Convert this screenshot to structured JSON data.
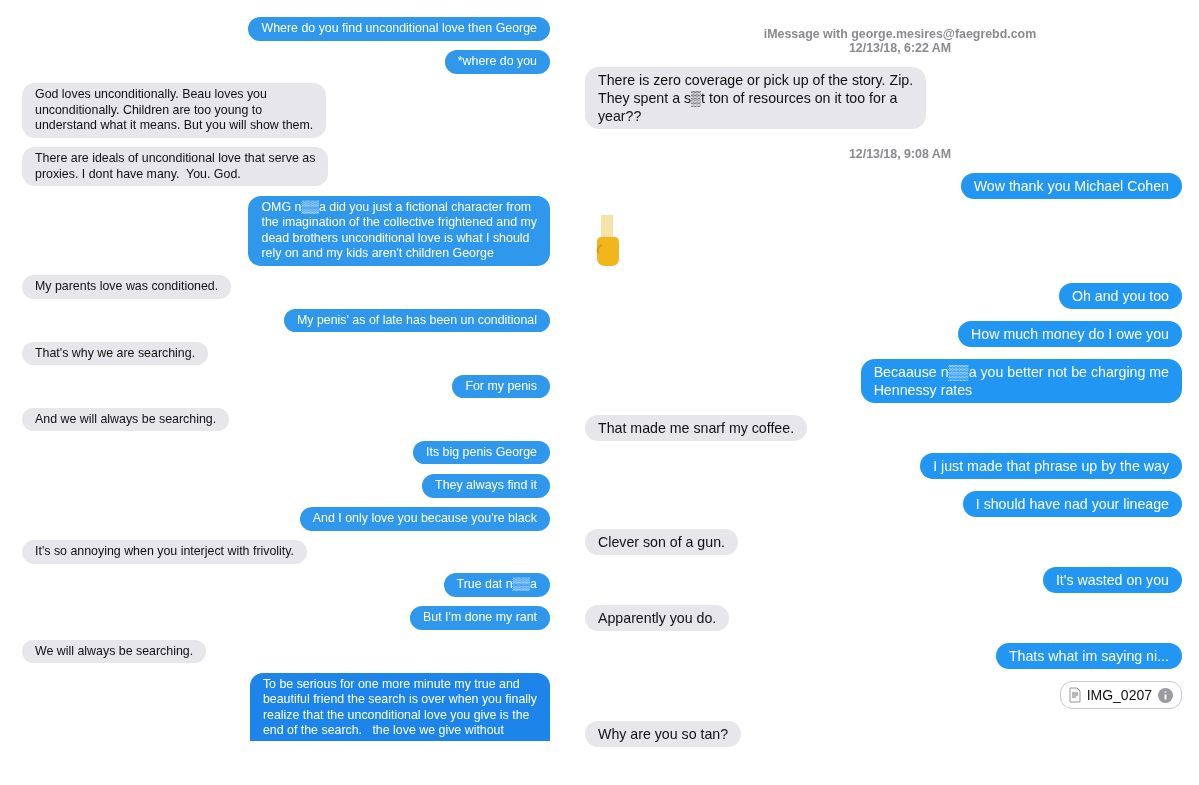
{
  "left_thread": {
    "messages": [
      {
        "kind": "outgoing",
        "text": "Where do you find unconditional love then George"
      },
      {
        "kind": "outgoing",
        "text": "*where do you"
      },
      {
        "kind": "incoming",
        "text": "God loves unconditionally. Beau loves you\nunconditionally. Children are too young to\nunderstand what it means. But you will show them."
      },
      {
        "kind": "incoming",
        "text": "There are ideals of unconditional love that serve as\nproxies. I dont have many.  You. God."
      },
      {
        "kind": "outgoing",
        "text": "OMG n▒▒a did you just a fictional character from\nthe imagination of the collective frightened and my\ndead brothers unconditional love is what I should\nrely on and my kids aren't children George"
      },
      {
        "kind": "incoming",
        "text": "My parents love was conditioned."
      },
      {
        "kind": "outgoing",
        "text": "My penis' as of late has been un conditional"
      },
      {
        "kind": "incoming",
        "text": "That's why we are searching."
      },
      {
        "kind": "outgoing",
        "text": "For my penis"
      },
      {
        "kind": "incoming",
        "text": "And we will always be searching."
      },
      {
        "kind": "outgoing",
        "text": "Its big penis George"
      },
      {
        "kind": "outgoing",
        "text": "They always find it"
      },
      {
        "kind": "outgoing",
        "text": "And I only love you because you're black"
      },
      {
        "kind": "incoming",
        "text": "It's so annoying when you interject with frivolity."
      },
      {
        "kind": "outgoing",
        "text": "True dat n▒▒a"
      },
      {
        "kind": "outgoing",
        "text": "But I'm done my rant"
      },
      {
        "kind": "incoming",
        "text": "We will always be searching."
      },
      {
        "kind": "outgoing",
        "text": "To be serious for one more minute my true and\nbeautiful friend the search is over when you finally\nrealize that the unconditional love you give is the\nend of the search.   the love we give without"
      }
    ]
  },
  "right_thread": {
    "header": "iMessage with george.mesires@faegrebd.com",
    "items": [
      {
        "kind": "timestamp",
        "text": "12/13/18, 6:22 AM"
      },
      {
        "kind": "incoming",
        "text": "There is zero coverage or pick up of the story. Zip.\nThey spent a s▒t ton of resources on it too for a\nyear??"
      },
      {
        "kind": "timestamp",
        "text": "12/13/18, 9:08 AM"
      },
      {
        "kind": "outgoing",
        "text": "Wow thank you Michael Cohen"
      },
      {
        "kind": "emoji"
      },
      {
        "kind": "outgoing",
        "text": "Oh and you too"
      },
      {
        "kind": "outgoing",
        "text": "How much money do I owe you"
      },
      {
        "kind": "outgoing",
        "text": "Becaause n▒▒a you better not be charging me\nHennessy rates"
      },
      {
        "kind": "incoming",
        "text": "That made me snarf my coffee."
      },
      {
        "kind": "outgoing",
        "text": "I just made that phrase up by the way"
      },
      {
        "kind": "outgoing",
        "text": "I should have nad your lineage"
      },
      {
        "kind": "incoming",
        "text": "Clever son of a gun."
      },
      {
        "kind": "outgoing",
        "text": "It's wasted on you"
      },
      {
        "kind": "incoming",
        "text": "Apparently you do."
      },
      {
        "kind": "outgoing",
        "text": "Thats what im saying ni..."
      },
      {
        "kind": "attachment",
        "text": "IMG_0207"
      },
      {
        "kind": "incoming",
        "text": "Why are you so tan?"
      }
    ]
  }
}
